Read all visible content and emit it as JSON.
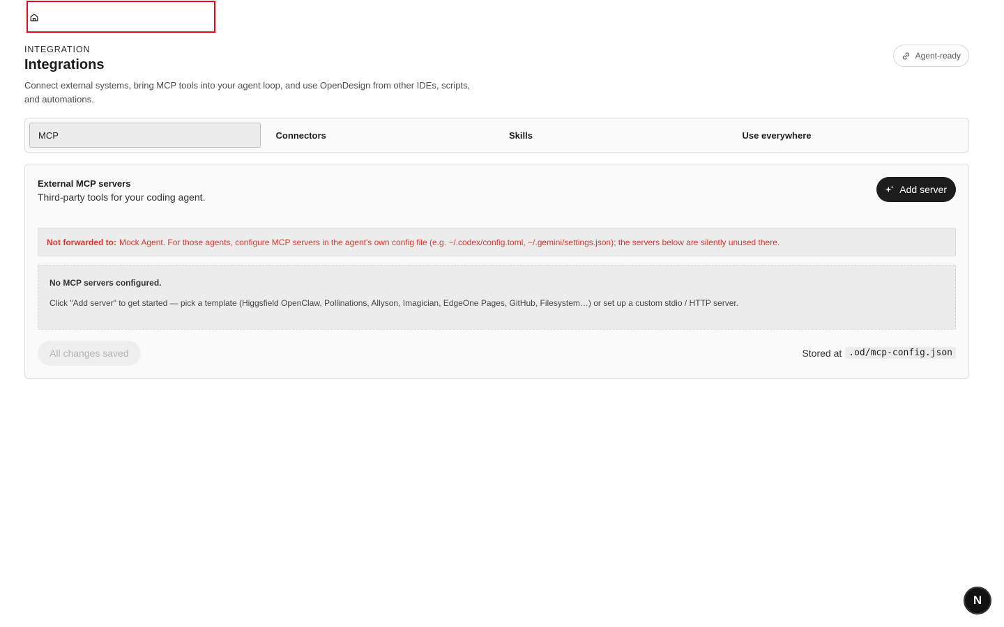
{
  "header": {
    "eyebrow": "INTEGRATION",
    "title": "Integrations",
    "description": "Connect external systems, bring MCP tools into your agent loop, and use OpenDesign from other IDEs, scripts, and automations.",
    "badge": "Agent-ready"
  },
  "tabs": [
    {
      "label": "MCP",
      "active": true
    },
    {
      "label": "Connectors",
      "active": false
    },
    {
      "label": "Skills",
      "active": false
    },
    {
      "label": "Use everywhere",
      "active": false
    }
  ],
  "panel": {
    "title": "External MCP servers",
    "subtitle": "Third-party tools for your coding agent.",
    "add_label": "Add server",
    "warning_bold": "Not forwarded to:",
    "warning_text": "Mock Agent. For those agents, configure MCP servers in the agent's own config file (e.g. ~/.codex/config.toml, ~/.gemini/settings.json); the servers below are silently unused there.",
    "empty_title": "No MCP servers configured.",
    "empty_text": "Click \"Add server\" to get started — pick a template (Higgsfield OpenClaw, Pollinations, Allyson, Imagician, EdgeOne Pages, GitHub, Filesystem…) or set up a custom stdio / HTTP server.",
    "saved_label": "All changes saved",
    "stored_prefix": "Stored at",
    "stored_path": ".od/mcp-config.json"
  },
  "corner_badge": "N",
  "colors": {
    "warning": "#d43b2f",
    "primary_button": "#1d1d1d",
    "highlight_box": "#e0101a"
  }
}
